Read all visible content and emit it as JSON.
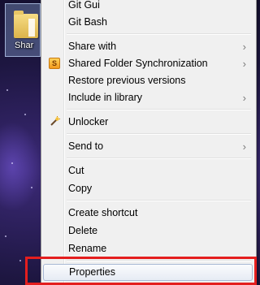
{
  "desktop": {
    "icon_label": "Shar"
  },
  "menu": {
    "items": [
      {
        "label": "Git Gui"
      },
      {
        "label": "Git Bash"
      },
      {
        "label": "Share with",
        "arrow": "›"
      },
      {
        "label": "Shared Folder Synchronization",
        "arrow": "›",
        "icon": "S"
      },
      {
        "label": "Restore previous versions"
      },
      {
        "label": "Include in library",
        "arrow": "›"
      },
      {
        "label": "Unlocker"
      },
      {
        "label": "Send to",
        "arrow": "›"
      },
      {
        "label": "Cut"
      },
      {
        "label": "Copy"
      },
      {
        "label": "Create shortcut"
      },
      {
        "label": "Delete"
      },
      {
        "label": "Rename"
      },
      {
        "label": "Properties"
      }
    ]
  },
  "colors": {
    "menu_background": "#f0f0f0",
    "highlight_border": "#e41e1e",
    "hover_border": "#a8b8d4"
  }
}
